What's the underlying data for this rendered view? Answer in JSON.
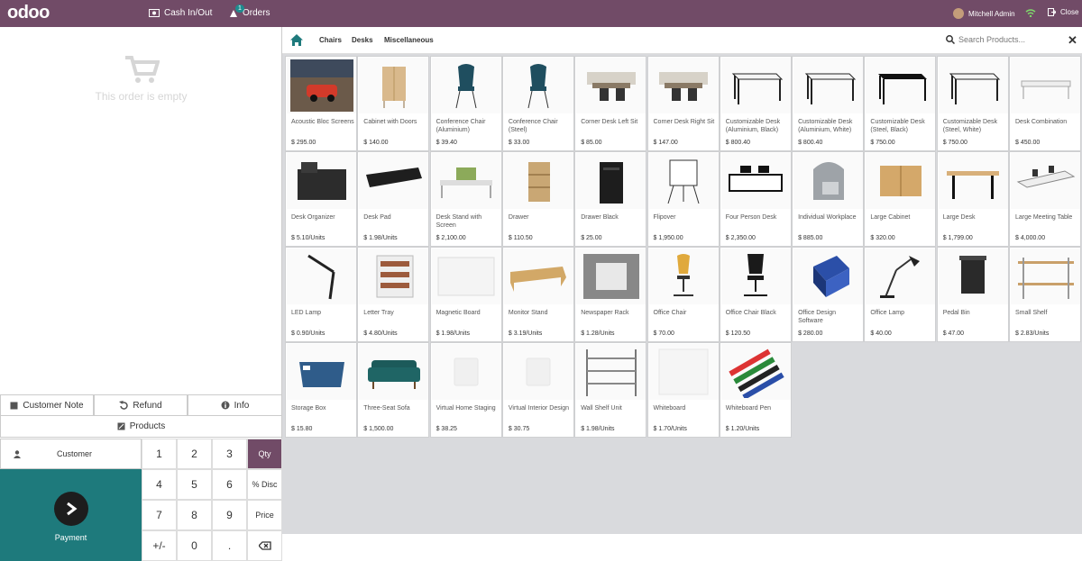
{
  "topbar": {
    "logo": "odoo",
    "cash": "Cash In/Out",
    "orders": "Orders",
    "orders_count": "1",
    "user": "Mitchell Admin",
    "close": "Close"
  },
  "order": {
    "empty": "This order is empty"
  },
  "controls": {
    "customer_note": "Customer Note",
    "refund": "Refund",
    "info": "Info",
    "products": "Products"
  },
  "numpad": {
    "customer": "Customer",
    "payment": "Payment",
    "keys": [
      "1",
      "2",
      "3",
      "Qty",
      "4",
      "5",
      "6",
      "% Disc",
      "7",
      "8",
      "9",
      "Price",
      "+/-",
      "0",
      ".",
      ""
    ]
  },
  "categories": {
    "items": [
      "Chairs",
      "Desks",
      "Miscellaneous"
    ],
    "search_placeholder": "Search Products..."
  },
  "products": [
    {
      "name": "Acoustic Bloc Screens",
      "price": "$ 295.00",
      "icon": "car-photo"
    },
    {
      "name": "Cabinet with Doors",
      "price": "$ 140.00",
      "icon": "cabinet"
    },
    {
      "name": "Conference Chair (Aluminium)",
      "price": "$ 39.40",
      "icon": "chair-blue"
    },
    {
      "name": "Conference Chair (Steel)",
      "price": "$ 33.00",
      "icon": "chair-blue"
    },
    {
      "name": "Corner Desk Left Sit",
      "price": "$ 85.00",
      "icon": "desk-pod"
    },
    {
      "name": "Corner Desk Right Sit",
      "price": "$ 147.00",
      "icon": "desk-pod"
    },
    {
      "name": "Customizable Desk (Aluminium, Black)",
      "price": "$ 800.40",
      "icon": "desk-white"
    },
    {
      "name": "Customizable Desk (Aluminium, White)",
      "price": "$ 800.40",
      "icon": "desk-white"
    },
    {
      "name": "Customizable Desk (Steel, Black)",
      "price": "$ 750.00",
      "icon": "desk-black"
    },
    {
      "name": "Customizable Desk (Steel, White)",
      "price": "$ 750.00",
      "icon": "desk-white"
    },
    {
      "name": "Desk Combination",
      "price": "$ 450.00",
      "icon": "desk-combo"
    },
    {
      "name": "Desk Organizer",
      "price": "$ 5.10/Units",
      "icon": "organizer"
    },
    {
      "name": "Desk Pad",
      "price": "$ 1.98/Units",
      "icon": "pad"
    },
    {
      "name": "Desk Stand with Screen",
      "price": "$ 2,100.00",
      "icon": "stand"
    },
    {
      "name": "Drawer",
      "price": "$ 110.50",
      "icon": "drawer"
    },
    {
      "name": "Drawer Black",
      "price": "$ 25.00",
      "icon": "drawer-black"
    },
    {
      "name": "Flipover",
      "price": "$ 1,950.00",
      "icon": "flipover"
    },
    {
      "name": "Four Person Desk",
      "price": "$ 2,350.00",
      "icon": "four-desk"
    },
    {
      "name": "Individual Workplace",
      "price": "$ 885.00",
      "icon": "workplace"
    },
    {
      "name": "Large Cabinet",
      "price": "$ 320.00",
      "icon": "large-cabinet"
    },
    {
      "name": "Large Desk",
      "price": "$ 1,799.00",
      "icon": "large-desk"
    },
    {
      "name": "Large Meeting Table",
      "price": "$ 4,000.00",
      "icon": "meeting-table"
    },
    {
      "name": "LED Lamp",
      "price": "$ 0.90/Units",
      "icon": "led-lamp"
    },
    {
      "name": "Letter Tray",
      "price": "$ 4.80/Units",
      "icon": "letter-tray"
    },
    {
      "name": "Magnetic Board",
      "price": "$ 1.98/Units",
      "icon": "board"
    },
    {
      "name": "Monitor Stand",
      "price": "$ 3.19/Units",
      "icon": "monitor-stand"
    },
    {
      "name": "Newspaper Rack",
      "price": "$ 1.28/Units",
      "icon": "rack"
    },
    {
      "name": "Office Chair",
      "price": "$ 70.00",
      "icon": "office-chair"
    },
    {
      "name": "Office Chair Black",
      "price": "$ 120.50",
      "icon": "office-chair-black"
    },
    {
      "name": "Office Design Software",
      "price": "$ 280.00",
      "icon": "software-box"
    },
    {
      "name": "Office Lamp",
      "price": "$ 40.00",
      "icon": "office-lamp"
    },
    {
      "name": "Pedal Bin",
      "price": "$ 47.00",
      "icon": "bin"
    },
    {
      "name": "Small Shelf",
      "price": "$ 2.83/Units",
      "icon": "shelf"
    },
    {
      "name": "Storage Box",
      "price": "$ 15.80",
      "icon": "storage-box"
    },
    {
      "name": "Three-Seat Sofa",
      "price": "$ 1,500.00",
      "icon": "sofa"
    },
    {
      "name": "Virtual Home Staging",
      "price": "$ 38.25",
      "icon": "placeholder"
    },
    {
      "name": "Virtual Interior Design",
      "price": "$ 30.75",
      "icon": "placeholder"
    },
    {
      "name": "Wall Shelf Unit",
      "price": "$ 1.98/Units",
      "icon": "wall-shelf"
    },
    {
      "name": "Whiteboard",
      "price": "$ 1.70/Units",
      "icon": "whiteboard"
    },
    {
      "name": "Whiteboard Pen",
      "price": "$ 1.20/Units",
      "icon": "pens"
    }
  ],
  "colors": {
    "brand": "#714b67",
    "payment": "#1e7a7c",
    "badge": "#1e8c8f"
  }
}
